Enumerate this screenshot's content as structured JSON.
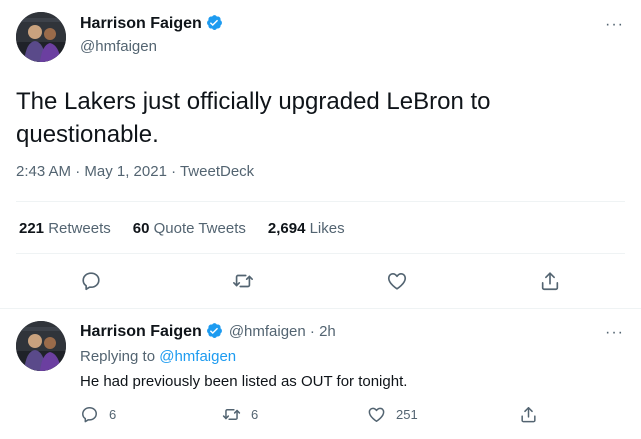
{
  "main_tweet": {
    "author_name": "Harrison Faigen",
    "handle": "@hmfaigen",
    "text": "The Lakers just officially upgraded LeBron to questionable.",
    "time": "2:43 AM · May 1, 2021 · TweetDeck",
    "stats": {
      "retweets_count": "221",
      "retweets_label": "Retweets",
      "quotes_count": "60",
      "quotes_label": "Quote Tweets",
      "likes_count": "2,694",
      "likes_label": "Likes"
    }
  },
  "reply_tweet": {
    "author_name": "Harrison Faigen",
    "handle_time": "@hmfaigen · 2h",
    "replying_to_prefix": "Replying to",
    "replying_to_handle": "@hmfaigen",
    "text": "He had previously been listed as OUT for tonight.",
    "reply_count": "6",
    "retweet_count": "6",
    "like_count": "251"
  },
  "more_label": "···",
  "colors": {
    "accent": "#1d9bf0",
    "text": "#0f1419",
    "muted": "#536471",
    "divider": "#eff3f4"
  }
}
